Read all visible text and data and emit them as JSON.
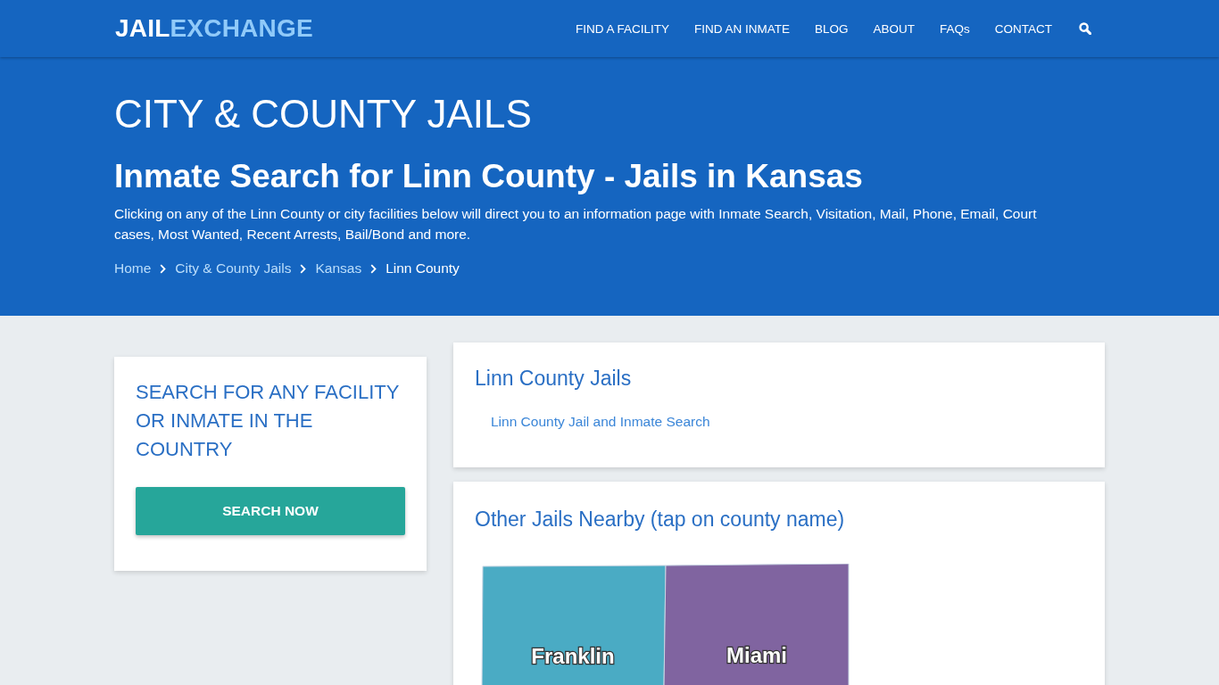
{
  "header": {
    "logo": {
      "primary": "JAIL",
      "accent": "EXCHANGE"
    },
    "nav": [
      "FIND A FACILITY",
      "FIND AN INMATE",
      "BLOG",
      "ABOUT",
      "FAQs",
      "CONTACT"
    ]
  },
  "hero": {
    "title": "CITY & COUNTY JAILS",
    "subtitle": "Inmate Search for Linn County - Jails in Kansas",
    "description": "Clicking on any of the Linn County or city facilities below will direct you to an information page with Inmate Search, Visitation, Mail, Phone, Email, Court cases, Most Wanted, Recent Arrests, Bail/Bond and more.",
    "breadcrumb": [
      {
        "label": "Home",
        "current": false
      },
      {
        "label": "City & County Jails",
        "current": false
      },
      {
        "label": "Kansas",
        "current": false
      },
      {
        "label": "Linn County",
        "current": true
      }
    ]
  },
  "search_card": {
    "heading": "SEARCH FOR ANY FACILITY OR INMATE IN THE COUNTRY",
    "button": "SEARCH NOW"
  },
  "jails_card": {
    "heading": "Linn County Jails",
    "links": [
      "Linn County Jail and Inmate Search"
    ]
  },
  "nearby_card": {
    "heading": "Other Jails Nearby (tap on county name)",
    "counties": [
      {
        "name": "Franklin",
        "color": "#4aabc4"
      },
      {
        "name": "Miami",
        "color": "#8064a0"
      }
    ]
  }
}
